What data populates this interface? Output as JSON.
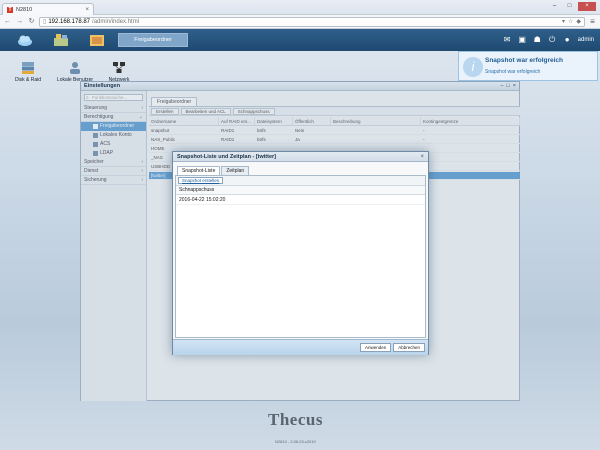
{
  "browser": {
    "tab_title": "N2810",
    "url_host": "192.168.178.87",
    "url_path": "/admin/index.html"
  },
  "topbar": {
    "active_tab": "Freigabeordner",
    "user": "admin"
  },
  "notification": {
    "title": "Snapshot war erfolgreich",
    "message": "Snapshot war erfolgreich"
  },
  "desktop": {
    "icons": [
      {
        "label": "Disk & Raid"
      },
      {
        "label": "Lokale Benutzer"
      },
      {
        "label": "Netzwerk"
      }
    ]
  },
  "settings": {
    "title": "Einstellungen",
    "search_placeholder": "Funktionssuche...",
    "sidebar": [
      {
        "label": "Steuerung"
      },
      {
        "label": "Berechtigung"
      },
      {
        "label": "Freigabeordner"
      },
      {
        "label": "Lokales Konto"
      },
      {
        "label": "ACS"
      },
      {
        "label": "LDAP"
      },
      {
        "label": "Speicher"
      },
      {
        "label": "Dienst"
      },
      {
        "label": "Sicherung"
      }
    ],
    "outer_tab": "Freigabeordner",
    "toolbar": [
      "Erstellen",
      "Bearbeiten und ACL",
      "Schnappschuss"
    ],
    "columns": [
      "Ordnername",
      "Auf RAID ers...",
      "Dateisystem",
      "Öffentlich",
      "Beschreibung",
      "Kontingentgrenze"
    ],
    "rows": [
      [
        "snapshot",
        "RAID1",
        "btrfs",
        "Nein",
        "",
        "-"
      ],
      [
        "NAS_Public",
        "RAID1",
        "btrfs",
        "Ja",
        "",
        "-"
      ],
      [
        "HOME",
        "",
        "",
        "",
        "",
        ""
      ],
      [
        "_NAS",
        "",
        "",
        "",
        "",
        ""
      ],
      [
        "USBHDD",
        "",
        "",
        "",
        "",
        ""
      ],
      [
        "[twitter]",
        "",
        "",
        "",
        "",
        ""
      ]
    ]
  },
  "footer": {
    "brand": "Thecus",
    "version": "N2810 - 2.06.03.c2010"
  },
  "dialog": {
    "title": "Snapshot-Liste und Zeitplan - [twitter]",
    "tabs": [
      "Snapshot-Liste",
      "Zeitplan"
    ],
    "create_button": "Snapshot erstellen",
    "list_header": "Schnappschuss",
    "rows": [
      "2016-04-22 15:02:20"
    ],
    "apply_button": "Anwenden",
    "cancel_button": "Abbrechen"
  },
  "colors": {
    "accent": "#3c8ccd",
    "topbar": "#1f4a70"
  }
}
